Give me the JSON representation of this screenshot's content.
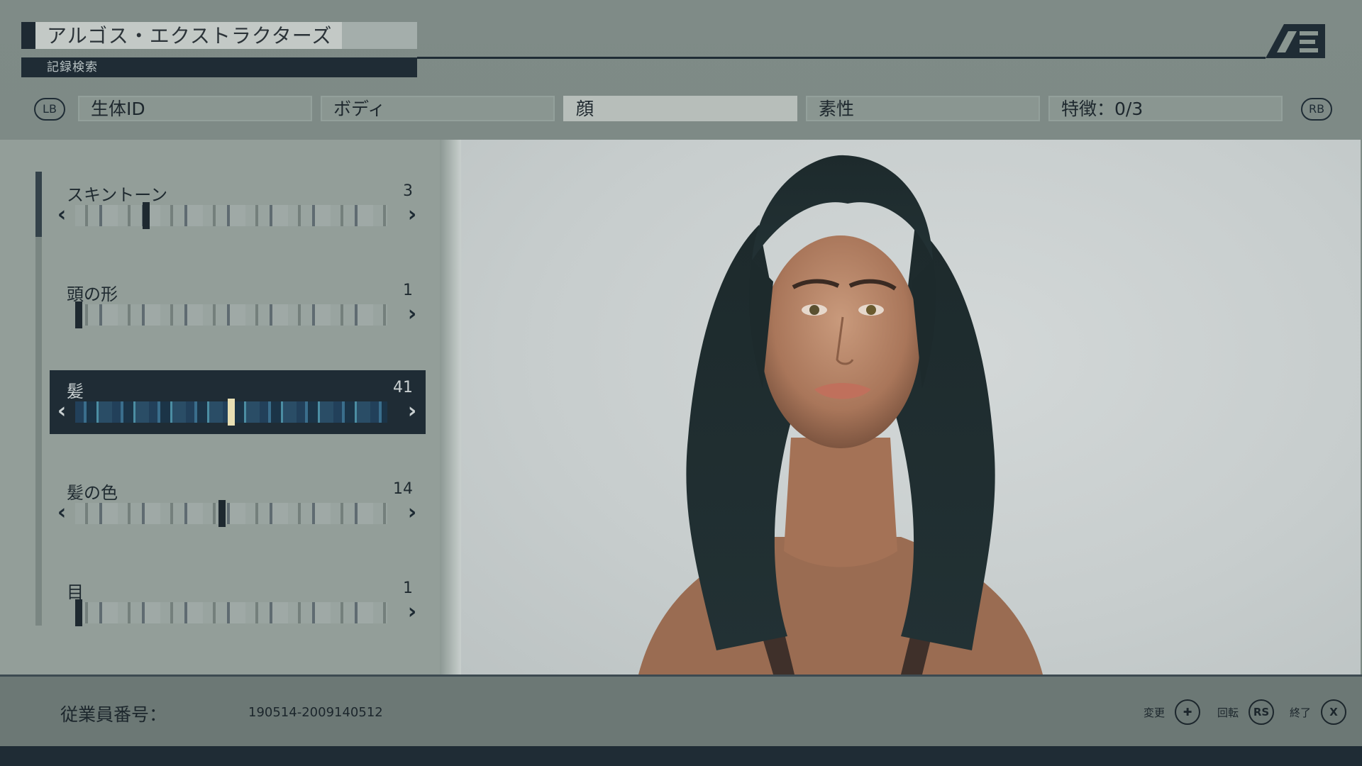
{
  "header": {
    "title": "アルゴス・エクストラクターズ",
    "subtitle": "記録検索",
    "logo": "AE-logo"
  },
  "tabs": {
    "prev_button": "LB",
    "next_button": "RB",
    "items": [
      {
        "label": "生体ID",
        "active": false
      },
      {
        "label": "ボディ",
        "active": false
      },
      {
        "label": "顔",
        "active": true
      },
      {
        "label": "素性",
        "active": false
      },
      {
        "label": "特徴：0/3",
        "active": false
      }
    ]
  },
  "sliders": [
    {
      "label": "スキントーン",
      "value": "3",
      "selected": false,
      "level": 0.22
    },
    {
      "label": "頭の形",
      "value": "1",
      "selected": false,
      "level": 0.0
    },
    {
      "label": "髪",
      "value": "41",
      "selected": true,
      "level": 0.5
    },
    {
      "label": "髪の色",
      "value": "14",
      "selected": false,
      "level": 0.47
    },
    {
      "label": "目",
      "value": "1",
      "selected": false,
      "level": 0.0
    }
  ],
  "viewport": {
    "subject": "character-face-preview"
  },
  "footer": {
    "employee_label": "従業員番号：",
    "employee_number": "190514-2009140512",
    "hints": [
      {
        "label": "変更",
        "button": "✚",
        "icon": "dpad-icon"
      },
      {
        "label": "回転",
        "button": "RS",
        "icon": "rs-button-icon"
      },
      {
        "label": "終了",
        "button": "X",
        "icon": "x-button-icon"
      }
    ]
  },
  "colors": {
    "background": "#7f8b87",
    "panel": "#939e99",
    "dark_accent": "#1f2c35",
    "selected_tick": "#e8dfb4"
  }
}
